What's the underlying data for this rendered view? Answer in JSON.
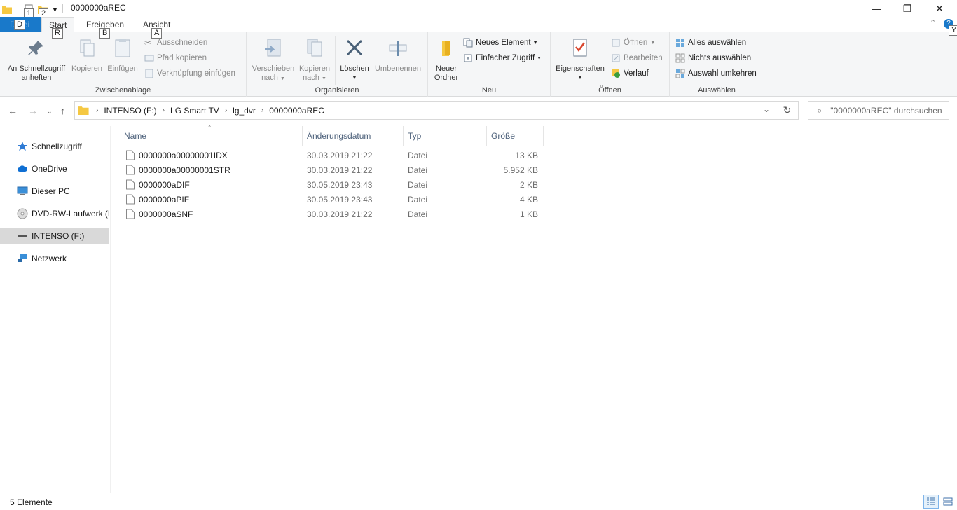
{
  "window": {
    "title": "0000000aREC",
    "minimize": "—",
    "maximize": "❐",
    "close": "✕"
  },
  "keytips": {
    "qat1": "1",
    "qat2": "2",
    "file": "D",
    "start": "R",
    "freigeben": "B",
    "ansicht": "A",
    "help": "Y"
  },
  "tabs": {
    "file": "Datei",
    "start": "Start",
    "freigeben": "Freigeben",
    "ansicht": "Ansicht"
  },
  "ribbon": {
    "clipboard": {
      "label": "Zwischenablage",
      "pin_line1": "An Schnellzugriff",
      "pin_line2": "anheften",
      "copy": "Kopieren",
      "paste": "Einfügen",
      "cut": "Ausschneiden",
      "copy_path": "Pfad kopieren",
      "paste_shortcut": "Verknüpfung einfügen"
    },
    "organize": {
      "label": "Organisieren",
      "move_line1": "Verschieben",
      "move_line2": "nach",
      "copyto_line1": "Kopieren",
      "copyto_line2": "nach",
      "delete": "Löschen",
      "rename": "Umbenennen"
    },
    "new": {
      "label": "Neu",
      "folder_line1": "Neuer",
      "folder_line2": "Ordner",
      "new_item": "Neues Element",
      "easy_access": "Einfacher Zugriff"
    },
    "open": {
      "label": "Öffnen",
      "properties": "Eigenschaften",
      "open": "Öffnen",
      "edit": "Bearbeiten",
      "history": "Verlauf"
    },
    "select": {
      "label": "Auswählen",
      "select_all": "Alles auswählen",
      "select_none": "Nichts auswählen",
      "invert": "Auswahl umkehren"
    }
  },
  "address": {
    "crumbs": [
      "INTENSO (F:)",
      "LG Smart TV",
      "lg_dvr",
      "0000000aREC"
    ],
    "search_placeholder": "\"0000000aREC\" durchsuchen"
  },
  "sidebar": {
    "items": [
      {
        "label": "Schnellzugriff"
      },
      {
        "label": "OneDrive"
      },
      {
        "label": "Dieser PC"
      },
      {
        "label": "DVD-RW-Laufwerk (E"
      },
      {
        "label": "INTENSO (F:)"
      },
      {
        "label": "Netzwerk"
      }
    ]
  },
  "columns": {
    "name": "Name",
    "date": "Änderungsdatum",
    "type": "Typ",
    "size": "Größe"
  },
  "files": [
    {
      "name": "0000000a00000001IDX",
      "date": "30.03.2019 21:22",
      "type": "Datei",
      "size": "13 KB"
    },
    {
      "name": "0000000a00000001STR",
      "date": "30.03.2019 21:22",
      "type": "Datei",
      "size": "5.952 KB"
    },
    {
      "name": "0000000aDIF",
      "date": "30.05.2019 23:43",
      "type": "Datei",
      "size": "2 KB"
    },
    {
      "name": "0000000aPIF",
      "date": "30.05.2019 23:43",
      "type": "Datei",
      "size": "4 KB"
    },
    {
      "name": "0000000aSNF",
      "date": "30.03.2019 21:22",
      "type": "Datei",
      "size": "1 KB"
    }
  ],
  "status": {
    "count": "5 Elemente"
  },
  "colors": {
    "accent": "#1979ca",
    "selected": "#d9d9d9"
  }
}
